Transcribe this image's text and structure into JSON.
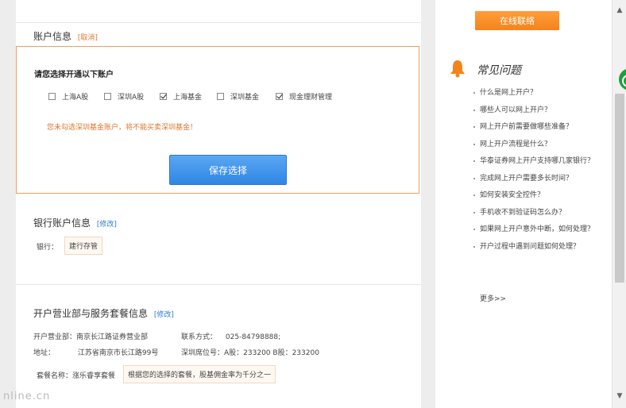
{
  "account_section": {
    "title": "账户信息",
    "cancel_label": "[取消]",
    "choose_title": "请您选择开通以下账户",
    "options": [
      {
        "label": "上海A股",
        "checked": false
      },
      {
        "label": "深圳A股",
        "checked": false
      },
      {
        "label": "上海基金",
        "checked": true
      },
      {
        "label": "深圳基金",
        "checked": false
      },
      {
        "label": "现金理财管理",
        "checked": true
      }
    ],
    "warning": "您未勾选深圳基金账户，将不能买卖深圳基金！",
    "save_label": "保存选择"
  },
  "bank_section": {
    "title": "银行账户信息",
    "edit_label": "[修改]",
    "bank_label": "银行：",
    "bank_value": "建行存管"
  },
  "branch_section": {
    "title": "开户营业部与服务套餐信息",
    "edit_label": "[修改]",
    "branch_label": "开户营业部：",
    "branch_value": "南京长江路证券营业部",
    "contact_label": "联系方式：",
    "contact_value": "025-84798888;",
    "address_label": "地址：",
    "address_value": "江苏省南京市长江路99号",
    "seat_label": "深圳席位号：",
    "seat_value": "A股：233200 B股：233200",
    "package_label": "套餐名称：",
    "package_value": "涨乐睿享套餐",
    "package_note": "根据您的选择的套餐，股基佣金率为千分之一"
  },
  "sidebar": {
    "online_contact": "在线联络",
    "faq_title": "常见问题",
    "faq_items": [
      "什么是网上开户？",
      "哪些人可以网上开户？",
      "网上开户前需要做哪些准备？",
      "网上开户流程是什么？",
      "华泰证券网上开户支持哪几家银行？",
      "完成网上开户需要多长时间？",
      "如何安装安全控件？",
      "手机收不到验证码怎么办？",
      "如果网上开户意外中断，如何处理？",
      "开户过程中遇到问题如何处理？"
    ],
    "more_label": "更多>>"
  },
  "watermark": "nline.cn",
  "colors": {
    "accent_orange": "#f5831b",
    "link_blue": "#2b7bd6",
    "button_blue": "#2f86e6"
  }
}
